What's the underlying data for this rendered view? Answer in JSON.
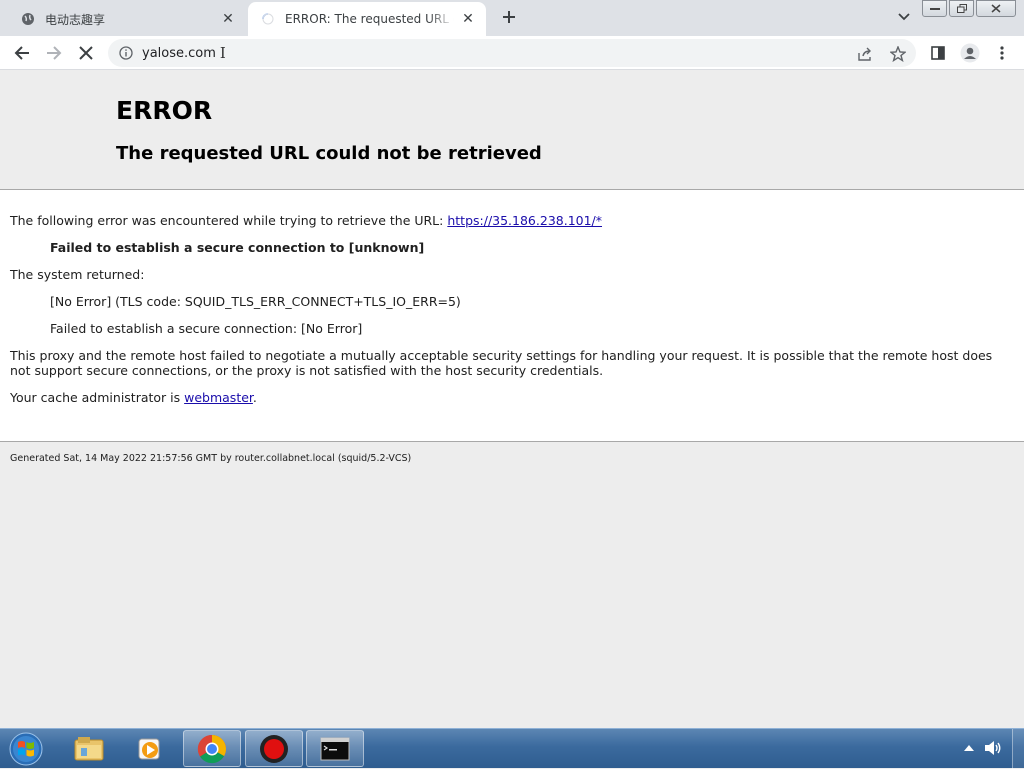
{
  "browser": {
    "tabs": [
      {
        "title": "电动志趣享",
        "active": false,
        "favicon": "globe-icon"
      },
      {
        "title": "ERROR: The requested URL could not be retrieved",
        "active": true,
        "favicon": "loading-spinner-icon"
      }
    ],
    "address": "yalose.com"
  },
  "page": {
    "title": "ERROR",
    "subtitle": "The requested URL could not be retrieved",
    "intro_text": "The following error was encountered while trying to retrieve the URL: ",
    "url_link": "https://35.186.238.101/*",
    "error_message": "Failed to establish a secure connection to [unknown]",
    "system_returned_label": "The system returned:",
    "tls_code": "[No Error] (TLS code: SQUID_TLS_ERR_CONNECT+TLS_IO_ERR=5)",
    "secure_connection_error": "Failed to establish a secure connection: [No Error]",
    "explanation": "This proxy and the remote host failed to negotiate a mutually acceptable security settings for handling your request. It is possible that the remote host does not support secure connections, or the proxy is not satisfied with the host security credentials.",
    "admin_prefix": "Your cache administrator is ",
    "admin_link": "webmaster",
    "admin_suffix": ".",
    "footer": "Generated Sat, 14 May 2022 21:57:56 GMT by router.collabnet.local (squid/5.2-VCS)"
  },
  "colors": {
    "link": "#1a0dab",
    "tabstrip": "#dee1e6",
    "page_bg": "#ededed",
    "taskbar": "#3b6a9e"
  },
  "taskbar": {
    "items": [
      "start-orb-icon",
      "file-explorer-icon",
      "media-player-icon",
      "chrome-icon",
      "record-icon",
      "command-prompt-icon"
    ]
  }
}
